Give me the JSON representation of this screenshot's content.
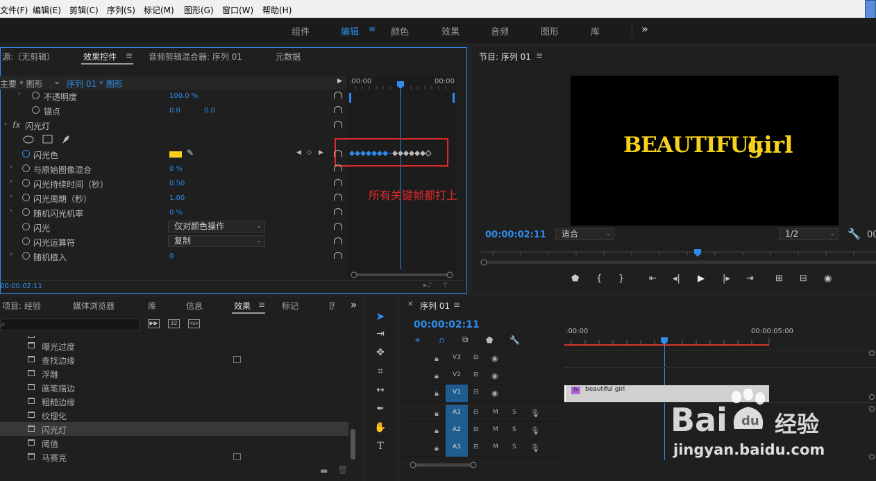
{
  "menu": [
    "文件(F)",
    "编辑(E)",
    "剪辑(C)",
    "序列(S)",
    "标记(M)",
    "图形(G)",
    "窗口(W)",
    "帮助(H)"
  ],
  "workspaces": [
    "组件",
    "编辑",
    "颜色",
    "效果",
    "音频",
    "图形",
    "库"
  ],
  "workspace_more": "»",
  "effect_panel": {
    "tabs": {
      "source": "源:（无剪辑）",
      "effect_controls": "效果控件",
      "audio_mixer": "音频剪辑混合器: 序列 01",
      "metadata": "元数据"
    },
    "clip_master": "主要 * 图形",
    "clip_seq": "序列 01 * 图形",
    "ruler_start": ":00:00",
    "ruler_end": "00:00",
    "opacity": {
      "label": "不透明度",
      "value": "100.0 %"
    },
    "anchor": {
      "label": "锚点",
      "x": "0.0",
      "y": "0.0"
    },
    "strobe_group": "闪光灯",
    "fx": "fx",
    "strobe_color": {
      "label": "闪光色",
      "swatch": "#f5d21b"
    },
    "blend": {
      "label": "与原始图像混合",
      "value": "0 %"
    },
    "duration": {
      "label": "闪光持续时间（秒）",
      "value": "0.50"
    },
    "period": {
      "label": "闪光周期（秒）",
      "value": "1.00"
    },
    "probability": {
      "label": "随机闪光机率",
      "value": "0 %"
    },
    "strobe": {
      "label": "闪光",
      "value": "仅对颜色操作"
    },
    "operator": {
      "label": "闪光运算符",
      "value": "复制"
    },
    "seed": {
      "label": "随机植入",
      "value": "0"
    },
    "timecode": "00:00:02:11",
    "annotation": "所有关键帧都打上"
  },
  "program": {
    "title": "节目: 序列 01",
    "headline_a": "BEAUTIFUL",
    "headline_b": "girl",
    "timecode": "00:00:02:11",
    "fit": "适合",
    "res": "1/2",
    "right_cut": "00"
  },
  "project_panel": {
    "tabs": [
      "项目: 经验",
      "媒体浏览器",
      "库",
      "信息",
      "效果",
      "标记",
      "历"
    ],
    "active_tab": "效果",
    "items": [
      "曝光过度",
      "查找边缘",
      "浮雕",
      "画笔描边",
      "粗糙边缘",
      "纹理化",
      "闪光灯",
      "阈值",
      "马赛克"
    ],
    "selected": "闪光灯",
    "badge32": "32",
    "badgeyuv": "YUV"
  },
  "timeline": {
    "title": "序列 01",
    "timecode": "00:00:02:11",
    "ruler_start": ":00:00",
    "ruler_mid": "00:00:05:00",
    "video_tracks": [
      "V3",
      "V2",
      "V1"
    ],
    "audio_tracks": [
      "A1",
      "A2",
      "A3"
    ],
    "m": "M",
    "s": "S",
    "clip_label": "beautiful   girl",
    "clip_fx": "fx"
  },
  "watermark": {
    "brand": "Bai",
    "brand2": "经验",
    "url": "jingyan.baidu.com"
  },
  "colors": {
    "accent": "#2d8ceb",
    "annotation": "#e02a2a",
    "title_yellow": "#f5d21b"
  }
}
